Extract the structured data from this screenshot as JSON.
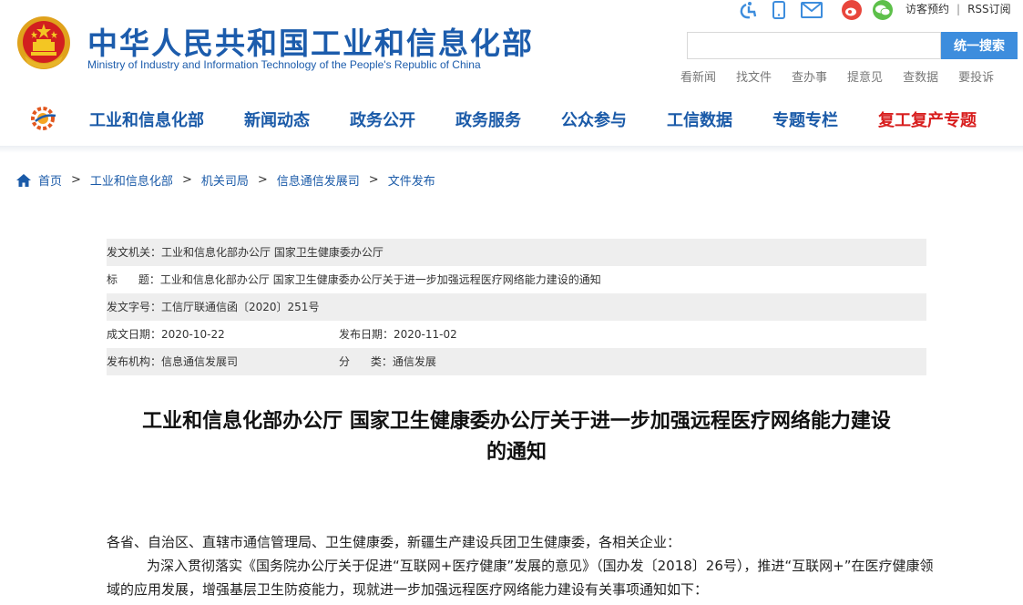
{
  "header": {
    "title": "中华人民共和国工业和信息化部",
    "subtitle": "Ministry of Industry and Information Technology of the People's Republic of China",
    "emblem_icon": "national-emblem-icon",
    "top_icons": [
      "accessibility-icon",
      "mobile-icon",
      "mail-icon",
      "weibo-icon",
      "wechat-icon"
    ],
    "visitor_link": "访客预约",
    "separator": "|",
    "rss_link": "RSS订阅",
    "search": {
      "value": "",
      "button": "统一搜索"
    },
    "quick_links": [
      "看新闻",
      "找文件",
      "查办事",
      "提意见",
      "查数据",
      "要投诉"
    ],
    "brand_color": "#1c5cac",
    "accent_red": "#d81e1e"
  },
  "nav": {
    "logo_icon": "gear-logo-icon",
    "items": [
      "工业和信息化部",
      "新闻动态",
      "政务公开",
      "政务服务",
      "公众参与",
      "工信数据",
      "专题专栏",
      "复工复产专题"
    ]
  },
  "breadcrumb": {
    "home_icon": "home-icon",
    "items": [
      "首页",
      "工业和信息化部",
      "机关司局",
      "信息通信发展司",
      "文件发布"
    ],
    "arrow": ">"
  },
  "meta": {
    "issuer": "发文机关：工业和信息化部办公厅 国家卫生健康委办公厅",
    "title": "标      题：工业和信息化部办公厅 国家卫生健康委办公厅关于进一步加强远程医疗网络能力建设的通知",
    "doc_no": "发文字号：工信厅联通信函〔2020〕251号",
    "created": "成文日期：2020-10-22",
    "published": "发布日期：2020-11-02",
    "agency": "发布机构：信息通信发展司",
    "category": "分      类：通信发展"
  },
  "article": {
    "title_line1": "工业和信息化部办公厅 国家卫生健康委办公厅关于进一步加强远程医疗网络能力建设",
    "title_line2": "的通知",
    "p1": "各省、自治区、直辖市通信管理局、卫生健康委，新疆生产建设兵团卫生健康委，各相关企业：",
    "p2": "为深入贯彻落实《国务院办公厅关于促进“互联网+医疗健康”发展的意见》（国办发〔2018〕26号），推进“互联网+”在医疗健康领域的应用发展，增强基层卫生防疫能力，现就进一步加强远程医疗网络能力建设有关事项通知如下："
  }
}
